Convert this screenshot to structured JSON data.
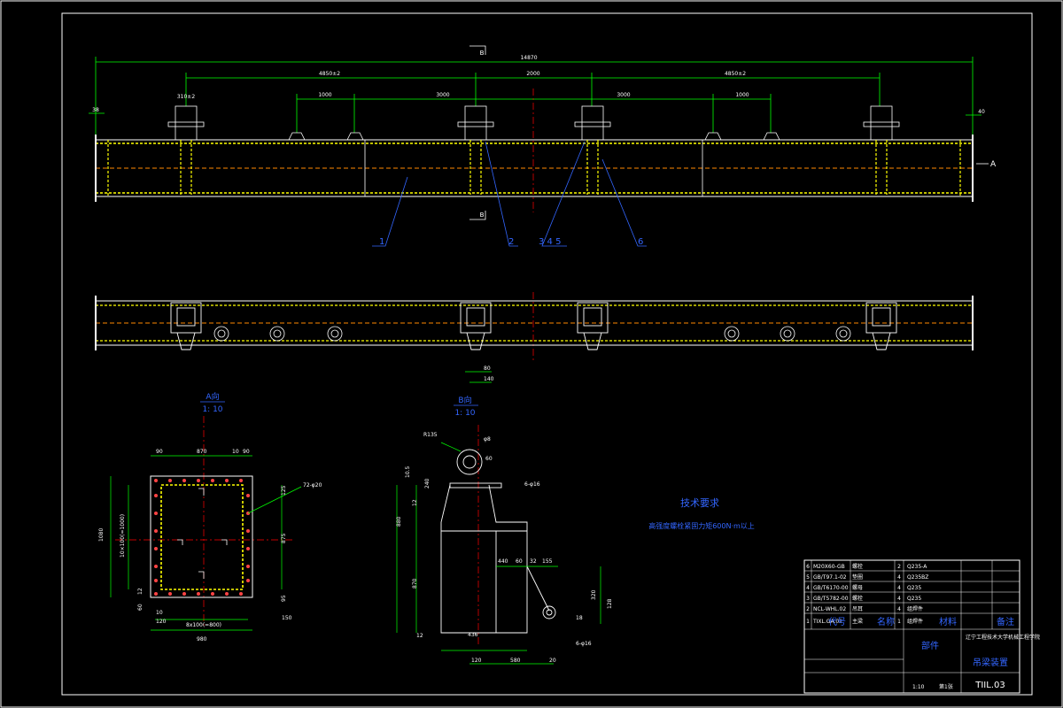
{
  "drawing": {
    "overall_length": "14870",
    "dim_4850_left": "4850±2",
    "dim_2000": "2000",
    "dim_4850_right": "4850±2",
    "dim_1000_left": "1000",
    "dim_3000_left": "3000",
    "dim_3000_right": "3000",
    "dim_1000_right": "1000",
    "dim_310": "310±2",
    "dim_40": "40",
    "dim_left_end": "38",
    "section_b_top": "B",
    "section_b_bot": "B",
    "view_arrow": "A",
    "balloons": [
      "1",
      "2",
      "3 4 5",
      "6"
    ],
    "dim_80": "80",
    "dim_140": "140",
    "view_a_title": "A向",
    "view_a_scale": "1: 10",
    "view_b_title": "B向",
    "view_b_scale": "1: 10",
    "va_dims": [
      "90",
      "870",
      "10",
      "90",
      "1080",
      "10×100(=1000)",
      "875",
      "125",
      "95",
      "8x100(=800)",
      "980",
      "12",
      "60",
      "10",
      "120",
      "150"
    ],
    "va_hole_note": "72-φ20",
    "vb_dims": [
      "R135",
      "φ8",
      "60",
      "10.5",
      "240",
      "12",
      "880",
      "870",
      "440",
      "60",
      "32",
      "155",
      "320",
      "128",
      "436",
      "12",
      "120",
      "580",
      "20",
      "18"
    ],
    "vb_weld_note_top": "6-φ16",
    "vb_weld_note_bot": "6-φ16",
    "tech_title": "技术要求",
    "tech_text": "高强度螺栓紧固力矩600N·m以上",
    "title_block": {
      "rows": [
        {
          "no": "6",
          "code": "M20X60-GB",
          "name": "螺栓",
          "qty": "2",
          "mat": "Q235-A"
        },
        {
          "no": "5",
          "code": "GB/T97.1-02",
          "name": "垫圈",
          "qty": "4",
          "mat": "Q235BZ"
        },
        {
          "no": "4",
          "code": "GB/T6170-00",
          "name": "螺母",
          "qty": "4",
          "mat": "Q235"
        },
        {
          "no": "3",
          "code": "GB/T5782-00",
          "name": "螺栓",
          "qty": "4",
          "mat": "Q235"
        },
        {
          "no": "2",
          "code": "NCL-WHL.02",
          "name": "吊耳",
          "qty": "4",
          "mat": "组焊件"
        },
        {
          "no": "1",
          "code": "TIXL.GA.01",
          "name": "主梁",
          "qty": "1",
          "mat": "组焊件"
        }
      ],
      "hdr_code": "代号",
      "hdr_name": "名称",
      "hdr_mat": "材料",
      "hdr_note": "备注",
      "part_label": "部件",
      "drawing_name": "吊梁装置",
      "drawing_no": "TIIL.03",
      "company": "辽宁工程技术大学机械工程学院",
      "scale_label": "1:10",
      "sheet_label": "第1张"
    }
  }
}
